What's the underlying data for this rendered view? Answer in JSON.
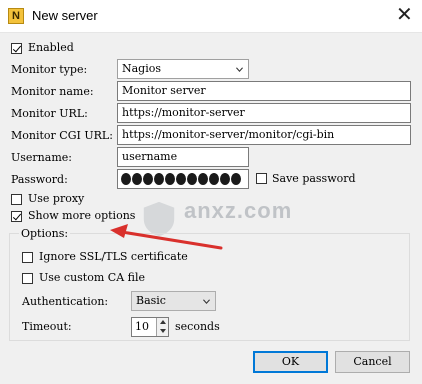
{
  "window": {
    "title": "New server",
    "icon": "app-icon-N",
    "icon_letter": "N",
    "close_icon": "close-icon"
  },
  "enabled": {
    "label": "Enabled",
    "checked": true
  },
  "monitor_type": {
    "label": "Monitor type:",
    "value": "Nagios"
  },
  "monitor_name": {
    "label": "Monitor name:",
    "value": "Monitor server"
  },
  "monitor_url": {
    "label": "Monitor URL:",
    "value": "https://monitor-server"
  },
  "monitor_cgi_url": {
    "label": "Monitor CGI URL:",
    "value": "https://monitor-server/monitor/cgi-bin"
  },
  "username": {
    "label": "Username:",
    "value": "username"
  },
  "password": {
    "label": "Password:",
    "masked_length": 11
  },
  "save_password": {
    "label": "Save password",
    "checked": false
  },
  "use_proxy": {
    "label": "Use proxy",
    "checked": false
  },
  "show_more_options": {
    "label": "Show more options",
    "checked": true
  },
  "options": {
    "legend": "Options:",
    "ignore_ssl": {
      "label": "Ignore SSL/TLS certificate",
      "checked": false
    },
    "custom_ca": {
      "label": "Use custom CA file",
      "checked": false
    },
    "authentication": {
      "label": "Authentication:",
      "value": "Basic"
    },
    "timeout": {
      "label": "Timeout:",
      "value": "10",
      "unit": "seconds"
    }
  },
  "buttons": {
    "ok": "OK",
    "cancel": "Cancel"
  },
  "watermark": {
    "text": "anxz.com"
  },
  "colors": {
    "accent": "#0078d7",
    "arrow": "#d9302c",
    "background": "#f0f0f0"
  }
}
